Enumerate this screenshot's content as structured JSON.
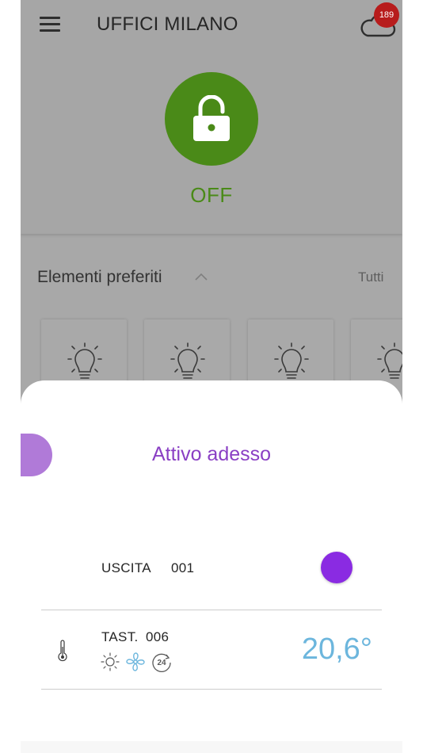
{
  "header": {
    "title": "UFFICI MILANO",
    "notification_count": "189"
  },
  "lock": {
    "status": "OFF",
    "color": "#4a8a18"
  },
  "favorites": {
    "title": "Elementi preferiti",
    "all_label": "Tutti"
  },
  "sheet": {
    "title": "Attivo adesso",
    "accent_color": "#8a3fc4",
    "rows": [
      {
        "label": "USCITA",
        "value": "001"
      },
      {
        "label": "TAST.",
        "value": "006",
        "temperature": "20,6°"
      }
    ]
  },
  "icons": [
    "menu-icon",
    "cloud-icon",
    "lock-open-icon",
    "chevron-up-icon",
    "bulb-icon",
    "thermometer-icon",
    "sun-icon",
    "fan-icon",
    "clock-24-icon"
  ]
}
